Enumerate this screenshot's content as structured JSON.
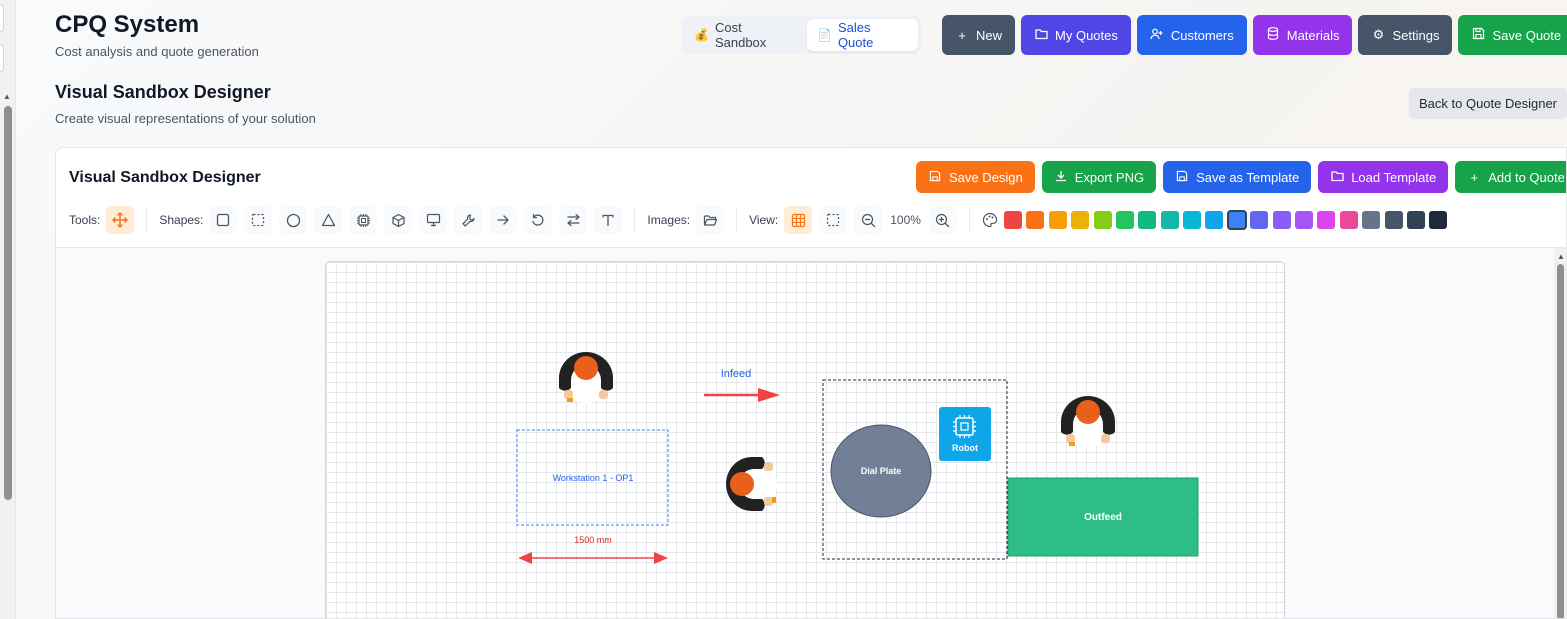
{
  "app": {
    "title": "CPQ System",
    "subtitle": "Cost analysis and quote generation"
  },
  "mode_tabs": [
    {
      "label": "Cost Sandbox",
      "icon": "money-bag-icon"
    },
    {
      "label": "Sales Quote",
      "icon": "document-icon",
      "active": true
    }
  ],
  "header_buttons": [
    {
      "label": "New",
      "icon": "plus-icon",
      "color": "#475569"
    },
    {
      "label": "My Quotes",
      "icon": "folder-icon",
      "color": "#4f46e5"
    },
    {
      "label": "Customers",
      "icon": "user-plus-icon",
      "color": "#2563eb"
    },
    {
      "label": "Materials",
      "icon": "database-icon",
      "color": "#9333ea"
    },
    {
      "label": "Settings",
      "icon": "gear-icon",
      "color": "#475569"
    },
    {
      "label": "Save Quote",
      "icon": "save-icon",
      "color": "#16a34a"
    }
  ],
  "section": {
    "title": "Visual Sandbox Designer",
    "subtitle": "Create visual representations of your solution",
    "back_label": "Back to Quote Designer"
  },
  "panel": {
    "title": "Visual Sandbox Designer",
    "actions": [
      {
        "label": "Save Design",
        "icon": "save-icon",
        "color": "#f97316"
      },
      {
        "label": "Export PNG",
        "icon": "download-icon",
        "color": "#16a34a"
      },
      {
        "label": "Save as Template",
        "icon": "save-icon",
        "color": "#2563eb"
      },
      {
        "label": "Load Template",
        "icon": "folder-icon",
        "color": "#9333ea"
      },
      {
        "label": "Add to Quote",
        "icon": "plus-icon",
        "color": "#16a34a"
      }
    ]
  },
  "toolbar": {
    "tools_label": "Tools:",
    "shapes_label": "Shapes:",
    "images_label": "Images:",
    "view_label": "View:",
    "zoom": "100%",
    "shapes": [
      "rectangle-icon",
      "dashed-rectangle-icon",
      "circle-icon",
      "triangle-icon",
      "chip-icon",
      "cube-icon",
      "monitor-icon",
      "wrench-icon",
      "arrow-right-icon",
      "rotate-icon",
      "swap-arrows-icon",
      "text-icon"
    ],
    "colors": [
      "#ef4444",
      "#f97316",
      "#f59e0b",
      "#eab308",
      "#84cc16",
      "#22c55e",
      "#10b981",
      "#14b8a6",
      "#06b6d4",
      "#0ea5e9",
      "#3b82f6",
      "#6366f1",
      "#8b5cf6",
      "#a855f7",
      "#d946ef",
      "#ec4899",
      "#64748b",
      "#475569",
      "#334155",
      "#1e293b"
    ],
    "selected_color": "#3b82f6"
  },
  "canvas": {
    "infeed_label": "Infeed",
    "workstation_label": "Workstation 1 - OP1",
    "dimension_label": "1500 mm",
    "dial_plate_label": "Dial Plate",
    "robot_label": "Robot",
    "outfeed_label": "Outfeed",
    "colors": {
      "arrow": "#ef4444",
      "dial_plate": "#718096",
      "robot": "#0ea5e9",
      "outfeed": "#2ebd86",
      "workstation": "#3b82f6"
    }
  }
}
